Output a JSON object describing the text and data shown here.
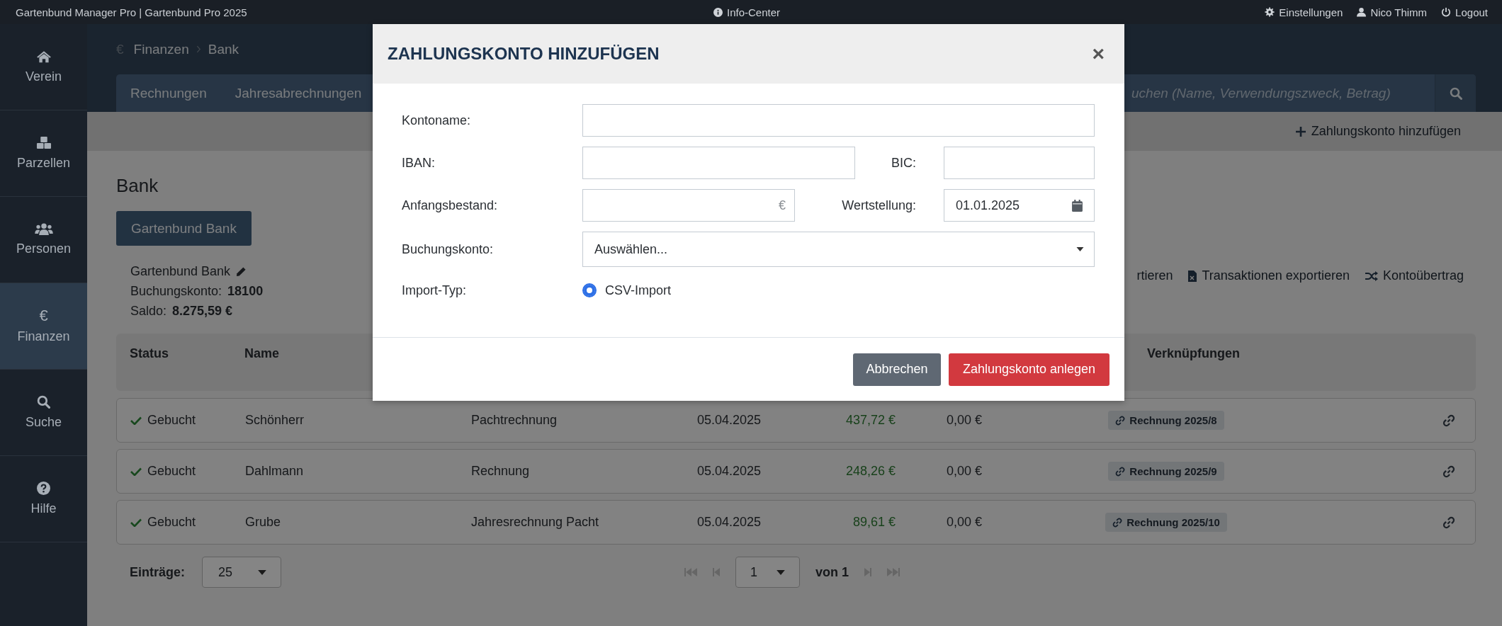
{
  "top_bar": {
    "title": "Gartenbund Manager Pro | Gartenbund Pro 2025",
    "center": {
      "label": "Info-Center",
      "kind": "info"
    },
    "links": [
      {
        "label": "Einstellungen",
        "kind": "settings"
      },
      {
        "label": "Nico Thimm",
        "kind": "user"
      },
      {
        "label": "Logout",
        "kind": "power"
      }
    ]
  },
  "sidebar": {
    "items": [
      {
        "label": "Verein",
        "kind": "home",
        "selected": false
      },
      {
        "label": "Parzellen",
        "kind": "parcels",
        "selected": false
      },
      {
        "label": "Personen",
        "kind": "people",
        "selected": false
      },
      {
        "label": "Finanzen",
        "kind": "glyph",
        "glyph": "€",
        "selected": true
      },
      {
        "label": "Suche",
        "kind": "search",
        "selected": false
      },
      {
        "label": "Hilfe",
        "kind": "help",
        "selected": false
      }
    ]
  },
  "breadcrumb": {
    "icon": "€",
    "items": [
      "Finanzen",
      "Bank"
    ]
  },
  "tabs": [
    "Rechnungen",
    "Jahresabrechnungen"
  ],
  "search": {
    "placeholder": "uchen (Name, Verwendungszweck, Betrag)"
  },
  "toolbar": {
    "action": "Zahlungskonto hinzufügen"
  },
  "heading": "Bank",
  "account_button": "Gartenbund Bank",
  "account_info": {
    "name": "Gartenbund Bank",
    "booking_account": "Buchungskonto: **18100**",
    "balance": "Saldo: **8.275,59 €**"
  },
  "actions": [
    {
      "label": "rtieren",
      "kind": "none"
    },
    {
      "label": "Transaktionen exportieren",
      "kind": "excel"
    },
    {
      "label": "Kontoübertrag",
      "kind": "transfer"
    }
  ],
  "table": {
    "header": {
      "status": "Status",
      "name": "Name",
      "links": "Verknüpfungen"
    },
    "rows": [
      {
        "status": "Gebucht",
        "name": "Schönherr",
        "column_3": "Pachtrechnung",
        "column_4": "05.04.2025",
        "column_5": "437,72 €",
        "column_6": "0,00 €",
        "link": "Rechnung 2025/8"
      },
      {
        "status": "Gebucht",
        "name": "Dahlmann",
        "column_3": "Rechnung",
        "column_4": "05.04.2025",
        "column_5": "248,26 €",
        "column_6": "0,00 €",
        "link": "Rechnung 2025/9"
      },
      {
        "status": "Gebucht",
        "name": "Grube",
        "column_3": "Jahresrechnung Pacht",
        "column_4": "05.04.2025",
        "column_5": "89,61 €",
        "column_6": "0,00 €",
        "link": "Rechnung 2025/10"
      }
    ]
  },
  "pagination": {
    "label": "Einträge:",
    "page_size": "25",
    "page": "1",
    "of": "von 1"
  },
  "modal": {
    "title": "ZAHLUNGSKONTO HINZUFÜGEN",
    "close": "×",
    "kontoname": {
      "label": "Kontoname:"
    },
    "iban": {
      "label": "IBAN:"
    },
    "bic": {
      "label": "BIC:"
    },
    "anfangsbestand": {
      "label": "Anfangsbestand:",
      "suffix": "€"
    },
    "wertstellung": {
      "label": "Wertstellung:",
      "value": "01.01.2025"
    },
    "buchungskonto": {
      "label": "Buchungskonto:",
      "value": "Auswählen..."
    },
    "import_typ": {
      "label": "Import-Typ:",
      "options": [
        {
          "label": "CSV-Import",
          "selected": true
        }
      ]
    },
    "buttons": [
      {
        "label": "Abbrechen",
        "kind": "cancel"
      },
      {
        "label": "Zahlungskonto anlegen",
        "kind": "primary"
      }
    ]
  }
}
